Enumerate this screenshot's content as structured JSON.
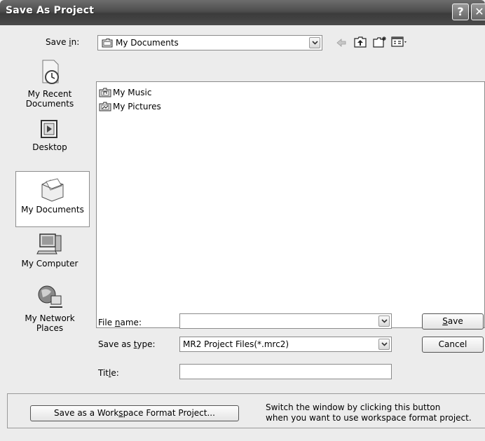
{
  "window": {
    "title": "Save As Project",
    "help_glyph": "?",
    "close_glyph": "✕"
  },
  "save_in": {
    "label": "Save in:",
    "value": "My Documents"
  },
  "places": [
    {
      "line1": "My Recent",
      "line2": "Documents"
    },
    {
      "line1": "Desktop",
      "line2": ""
    },
    {
      "line1": "My Documents",
      "line2": ""
    },
    {
      "line1": "My Computer",
      "line2": ""
    },
    {
      "line1": "My Network",
      "line2": "Places"
    }
  ],
  "files": [
    "My Music",
    "My Pictures"
  ],
  "file_name": {
    "label": "File name:",
    "value": ""
  },
  "save_as_type": {
    "label": "Save as type:",
    "value": "MR2 Project Files(*.mrc2)"
  },
  "title_field": {
    "label": "Title:",
    "value": ""
  },
  "buttons": {
    "save": "Save",
    "cancel": "Cancel",
    "workspace": "Save as a Workspace Format Project..."
  },
  "hint": {
    "line1": "Switch the window by clicking this button",
    "line2": "when you want to use workspace format project."
  },
  "icons": [
    "back-arrow-icon",
    "up-folder-icon",
    "new-folder-icon",
    "views-menu-icon",
    "help-icon",
    "close-icon"
  ]
}
